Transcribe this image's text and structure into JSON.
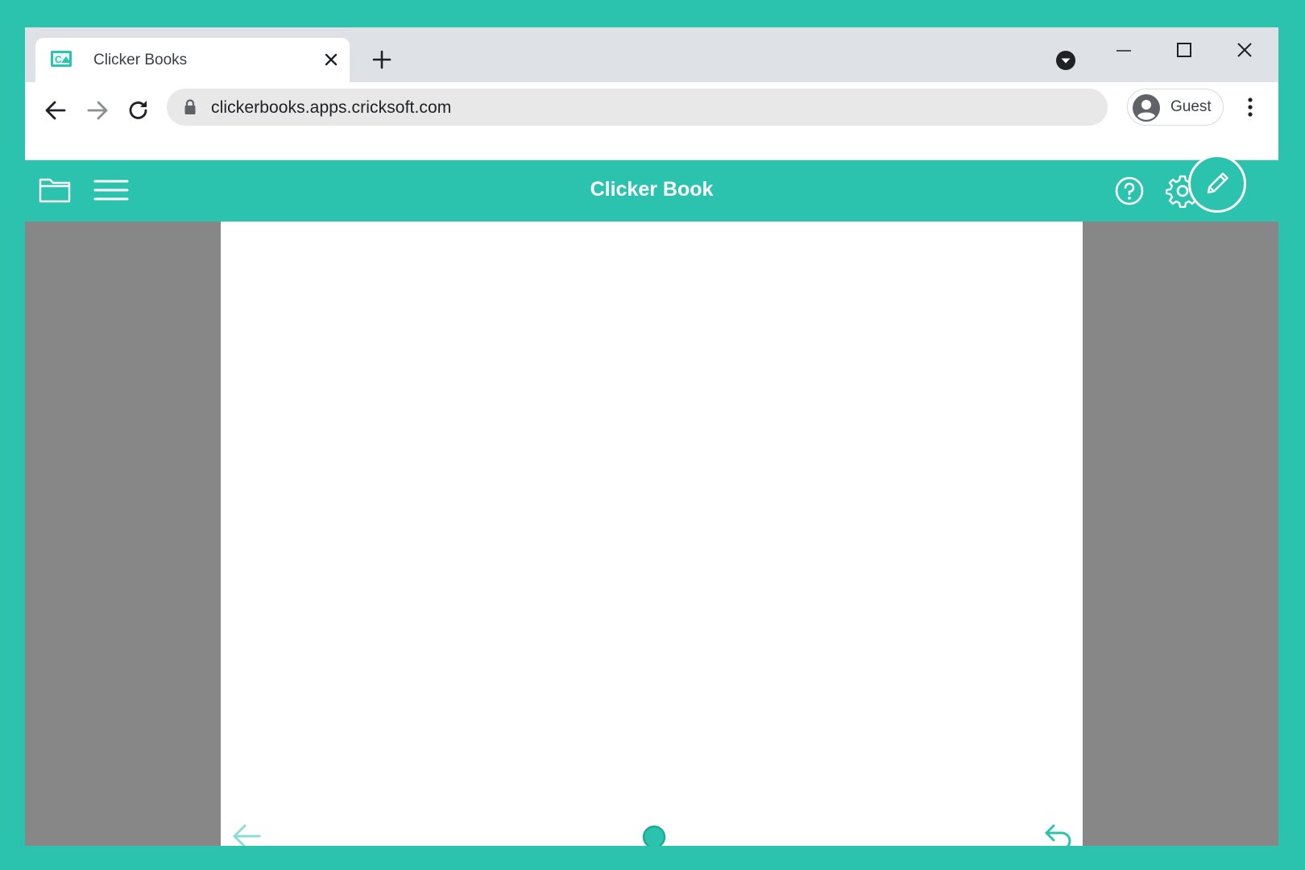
{
  "browser": {
    "tab": {
      "title": "Clicker Books"
    },
    "url": "clickerbooks.apps.cricksoft.com",
    "profile": {
      "name": "Guest"
    }
  },
  "app": {
    "title": "Clicker Book"
  },
  "colors": {
    "accent": "#2bc3ae",
    "background_gray": "#878787",
    "page_white": "#ffffff"
  },
  "icons": {
    "toolbar_left": [
      "folder-icon",
      "menu-icon"
    ],
    "toolbar_right": [
      "help-icon",
      "gear-icon",
      "pencil-icon"
    ],
    "page_nav": [
      "arrow-left-icon",
      "page-indicator-dot",
      "undo-icon"
    ]
  }
}
